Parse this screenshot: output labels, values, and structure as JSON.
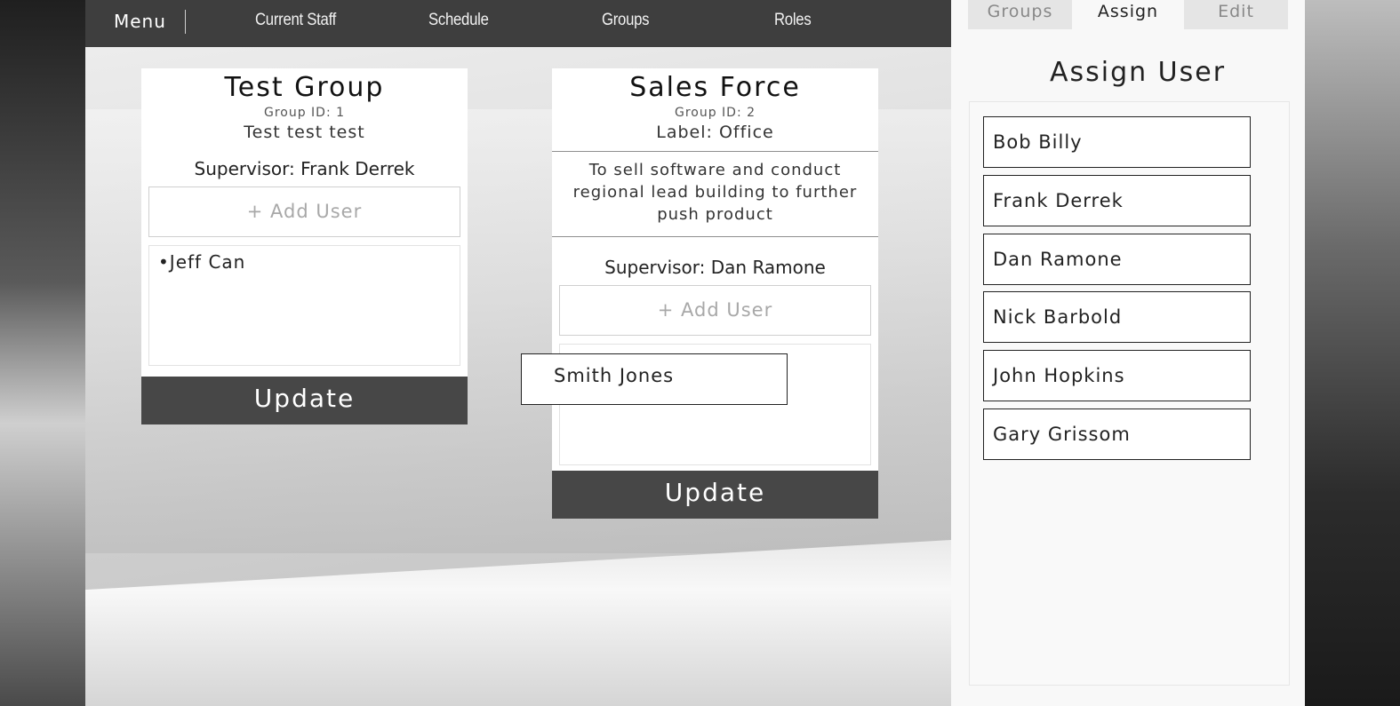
{
  "nav": {
    "menu": "Menu",
    "items": [
      "Current Staff",
      "Schedule",
      "Groups",
      "Roles"
    ]
  },
  "groups": [
    {
      "title": "Test Group",
      "group_id": "Group ID: 1",
      "label": "Test test test",
      "supervisor": "Supervisor: Frank Derrek",
      "add_user": "+ Add User",
      "members": [
        "•Jeff Can"
      ],
      "update": "Update"
    },
    {
      "title": "Sales Force",
      "group_id": "Group ID: 2",
      "label": "Label: Office",
      "description": "To sell software and conduct regional lead building to further push product",
      "supervisor": "Supervisor: Dan Ramone",
      "add_user": "+ Add User",
      "members": [],
      "update": "Update"
    }
  ],
  "dragging_user": "Smith Jones",
  "panel": {
    "tabs": [
      {
        "label": "Groups",
        "active": false
      },
      {
        "label": "Assign",
        "active": true
      },
      {
        "label": "Edit",
        "active": false
      }
    ],
    "title": "Assign User",
    "users": [
      "Bob Billy",
      "Frank Derrek",
      "Dan Ramone",
      "Nick Barbold",
      "John Hopkins",
      "Gary Grissom"
    ]
  },
  "colors": {
    "navbar": "#3e3e3e",
    "update_button": "#474747",
    "panel_background": "#f8f8f8"
  }
}
